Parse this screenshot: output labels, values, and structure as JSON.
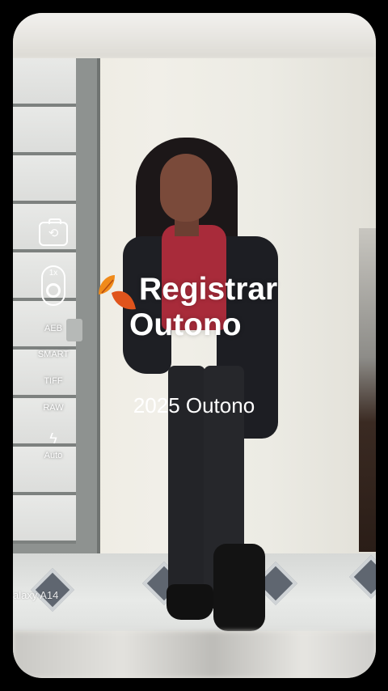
{
  "watermark": "alaxy A14",
  "camera_controls": {
    "camera_switch_icon": "camera-flip-icon",
    "zoom_label": "1x",
    "aeb_label": "AEB",
    "smart_label": "SMART",
    "tiff_label": "TIFF",
    "raw_label": "RAW",
    "flash_icon": "flash-icon",
    "flash_mode": "Auto"
  },
  "overlay": {
    "headline_line1": "Registrar",
    "headline_line2": "Outono",
    "subtitle": "2025 Outono",
    "leaf_icon": "autumn-leaves-icon",
    "colors": {
      "leaf_primary": "#f08a1a",
      "leaf_secondary": "#e0541c"
    }
  }
}
